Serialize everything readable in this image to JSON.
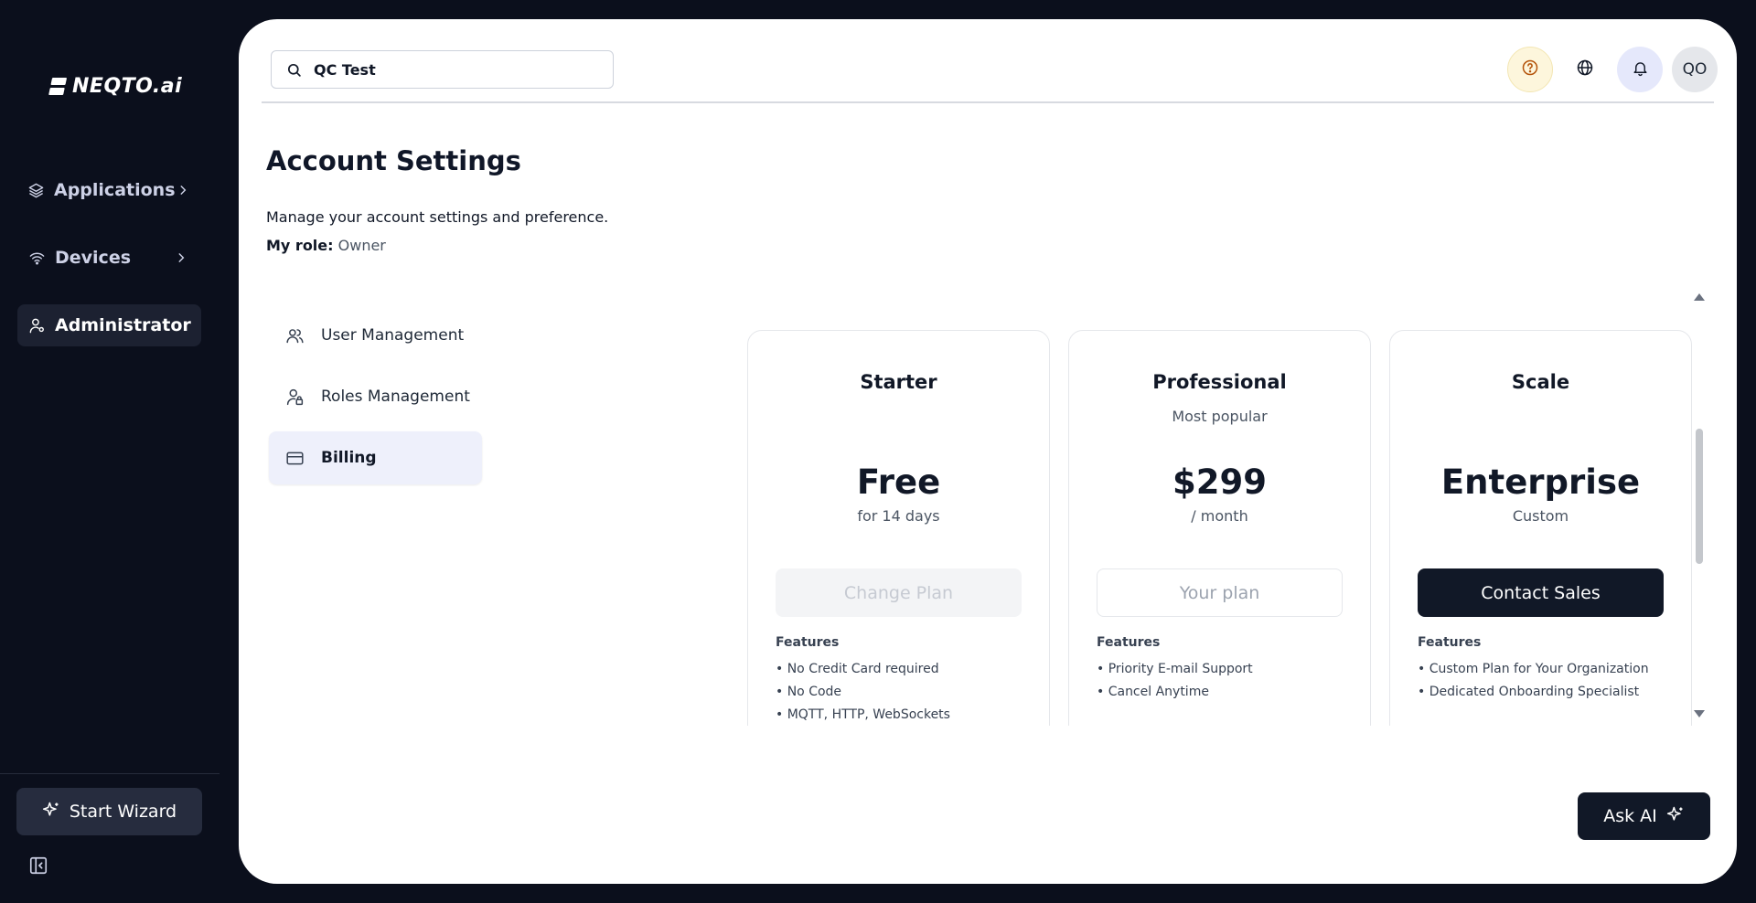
{
  "brand": {
    "name": "NEQTO.ai"
  },
  "sidebar": {
    "items": [
      {
        "label": "Applications",
        "icon": "layers-icon"
      },
      {
        "label": "Devices",
        "icon": "wifi-icon"
      },
      {
        "label": "Administrator",
        "icon": "user-cog-icon",
        "active": true
      }
    ],
    "wizard_label": "Start Wizard"
  },
  "header": {
    "search_value": "QC Test",
    "avatar_initials": "QO"
  },
  "page": {
    "title": "Account Settings",
    "description": "Manage your account settings and preference.",
    "role_label": "My role:",
    "role_value": "Owner"
  },
  "subnav": {
    "items": [
      {
        "label": "User Management",
        "icon": "users-icon"
      },
      {
        "label": "Roles Management",
        "icon": "user-lock-icon"
      },
      {
        "label": "Billing",
        "icon": "credit-card-icon",
        "active": true
      }
    ]
  },
  "plans": [
    {
      "name": "Starter",
      "tag": "",
      "price": "Free",
      "period": "for 14 days",
      "button": "Change Plan",
      "features_title": "Features",
      "features": [
        "• No Credit Card required",
        "• No Code",
        "• MQTT, HTTP, WebSockets"
      ]
    },
    {
      "name": "Professional",
      "tag": "Most popular",
      "price": "$299",
      "period": "/ month",
      "button": "Your plan",
      "features_title": "Features",
      "features": [
        "• Priority E-mail Support",
        "• Cancel Anytime"
      ]
    },
    {
      "name": "Scale",
      "tag": "",
      "price": "Enterprise",
      "period": "Custom",
      "button": "Contact Sales",
      "features_title": "Features",
      "features": [
        "• Custom Plan for Your Organization",
        "• Dedicated Onboarding Specialist"
      ]
    }
  ],
  "ask_ai_label": "Ask AI",
  "colors": {
    "background": "#0b0f1c",
    "accent_dark": "#111827",
    "active_subnav": "#eef0fb",
    "help_bg": "#fdf6dc"
  }
}
